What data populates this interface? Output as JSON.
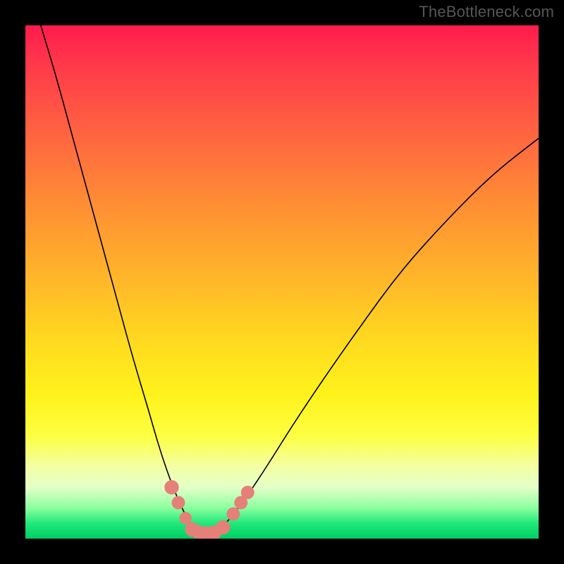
{
  "watermark": "TheBottleneck.com",
  "colors": {
    "frame": "#000000",
    "watermark_text": "#565656",
    "curve": "#000000",
    "marker": "#e58078",
    "gradient_stops": [
      "#ff1b4d",
      "#ff3a4a",
      "#ff6740",
      "#ff9133",
      "#ffb829",
      "#ffdb1f",
      "#fff21c",
      "#fdff42",
      "#f3ffa4",
      "#e4ffc8",
      "#8cff9f",
      "#21e87a",
      "#00cf63"
    ]
  },
  "chart_data": {
    "type": "line",
    "title": "",
    "xlabel": "",
    "ylabel": "",
    "xlim": [
      0,
      100
    ],
    "ylim": [
      0,
      100
    ],
    "grid": false,
    "legend": false,
    "note": "Axis values are normalized 0–100 estimates read from pixel positions; no numeric axes are drawn in the source image.",
    "series": [
      {
        "name": "left-branch",
        "values": [
          {
            "x": 3,
            "y": 100
          },
          {
            "x": 6,
            "y": 90
          },
          {
            "x": 9,
            "y": 79
          },
          {
            "x": 12,
            "y": 68
          },
          {
            "x": 15,
            "y": 57
          },
          {
            "x": 18,
            "y": 46
          },
          {
            "x": 21,
            "y": 35
          },
          {
            "x": 24,
            "y": 25
          },
          {
            "x": 26,
            "y": 18
          },
          {
            "x": 28,
            "y": 12
          },
          {
            "x": 30,
            "y": 7
          },
          {
            "x": 32,
            "y": 3
          },
          {
            "x": 33,
            "y": 1.5
          },
          {
            "x": 34,
            "y": 1
          },
          {
            "x": 35,
            "y": 1
          }
        ]
      },
      {
        "name": "right-branch",
        "values": [
          {
            "x": 35,
            "y": 1
          },
          {
            "x": 36,
            "y": 1
          },
          {
            "x": 38,
            "y": 2
          },
          {
            "x": 40,
            "y": 4
          },
          {
            "x": 43,
            "y": 8
          },
          {
            "x": 47,
            "y": 14
          },
          {
            "x": 52,
            "y": 22
          },
          {
            "x": 58,
            "y": 31
          },
          {
            "x": 65,
            "y": 41
          },
          {
            "x": 73,
            "y": 52
          },
          {
            "x": 82,
            "y": 62
          },
          {
            "x": 91,
            "y": 71
          },
          {
            "x": 100,
            "y": 78
          }
        ]
      }
    ],
    "markers": [
      {
        "x": 28.5,
        "y": 10,
        "r": 1.4
      },
      {
        "x": 29.8,
        "y": 7,
        "r": 1.3
      },
      {
        "x": 31.2,
        "y": 4,
        "r": 1.2
      },
      {
        "x": 32.5,
        "y": 1.8,
        "r": 1.4
      },
      {
        "x": 33.8,
        "y": 1.2,
        "r": 1.4
      },
      {
        "x": 35.3,
        "y": 1.0,
        "r": 1.4
      },
      {
        "x": 36.8,
        "y": 1.2,
        "r": 1.4
      },
      {
        "x": 38.5,
        "y": 2.2,
        "r": 1.4
      },
      {
        "x": 40.5,
        "y": 4.8,
        "r": 1.3
      },
      {
        "x": 42.0,
        "y": 7.0,
        "r": 1.3
      },
      {
        "x": 43.3,
        "y": 9.0,
        "r": 1.3
      }
    ]
  }
}
